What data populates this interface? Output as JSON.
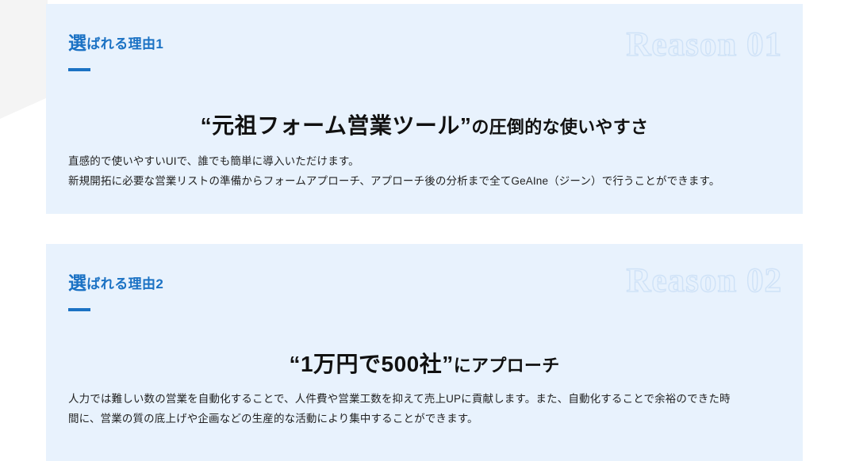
{
  "background": {
    "page_color": "#ffffff",
    "wedge_color": "#f4f4f4",
    "card_color": "#e8f2fd",
    "accent_color": "#1b72c4",
    "outline_number_color": "#cfe2f7"
  },
  "sections": [
    {
      "eyebrow_lead": "選",
      "eyebrow_rest": "ばれる理由1",
      "reason_number": "Reason 01",
      "headline_quoted": "“元祖フォーム営業ツール”",
      "headline_tail": "の圧倒的な使いやすさ",
      "body_lines": [
        "直感的で使いやすいUIで、誰でも簡単に導入いただけます。",
        "新規開拓に必要な営業リストの準備からフォームアプローチ、アプローチ後の分析まで全てGeAIne（ジーン）で行うことができます。"
      ]
    },
    {
      "eyebrow_lead": "選",
      "eyebrow_rest": "ばれる理由2",
      "reason_number": "Reason 02",
      "headline_quoted": "“1万円で500社”",
      "headline_tail": "にアプローチ",
      "body_lines": [
        "人力では難しい数の営業を自動化することで、人件費や営業工数を抑えて売上UPに貢献します。また、自動化することで余裕のできた時",
        "間に、営業の質の底上げや企画などの生産的な活動により集中することができます。"
      ]
    }
  ]
}
